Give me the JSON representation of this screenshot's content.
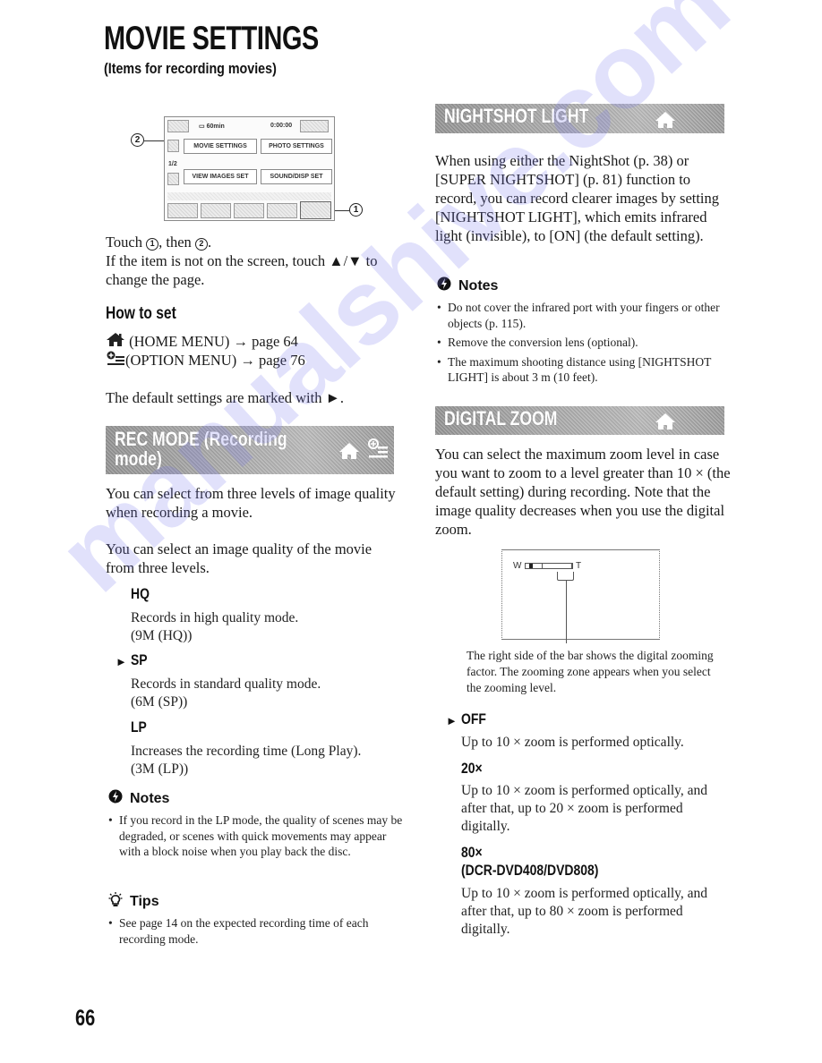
{
  "page": {
    "title": "MOVIE SETTINGS",
    "subtitle": "(Items for recording movies)",
    "page_number": "66",
    "watermark": "manualshive.com"
  },
  "lcd_screen": {
    "battery_time": "60min",
    "timecode": "0:00:00",
    "page_indicator": "1/2",
    "buttons": [
      "MOVIE SETTINGS",
      "PHOTO SETTINGS",
      "VIEW IMAGES SET",
      "SOUND/DISP SET"
    ],
    "callout_1": "1",
    "callout_2": "2"
  },
  "instructions": {
    "touch_prefix": "Touch ",
    "touch_mid": ", then ",
    "touch_suffix": ".",
    "circle_1": "1",
    "circle_2": "2",
    "line2": "If the item is not on the screen, touch ▲/▼ to change the page."
  },
  "how_to_set": {
    "heading": "How to set",
    "home_menu": "(HOME MENU) → page 64",
    "option_menu": "(OPTION MENU) → page 76",
    "default_note": "The default settings are marked with ►."
  },
  "rec_mode": {
    "banner_line1": "REC MODE (Recording",
    "banner_line2": "mode)",
    "intro1": "You can select from three levels of image quality when recording a movie.",
    "intro2": "You can select an image quality of the movie from three levels.",
    "options": [
      {
        "label": "HQ",
        "default": false,
        "desc": "Records in high quality mode.",
        "sub": "(9M (HQ))"
      },
      {
        "label": "SP",
        "default": true,
        "desc": "Records in standard quality mode.",
        "sub": "(6M (SP))"
      },
      {
        "label": "LP",
        "default": false,
        "desc": "Increases the recording time (Long Play).",
        "sub": "(3M (LP))"
      }
    ],
    "notes_heading": "Notes",
    "notes": [
      "If you record in the LP mode, the quality of scenes may be degraded, or scenes with quick movements may appear with a block noise when you play back the disc."
    ],
    "tips_heading": "Tips",
    "tips": [
      "See page 14 on the expected recording time of each recording mode."
    ]
  },
  "nightshot_light": {
    "banner": "NIGHTSHOT LIGHT",
    "body": "When using either the NightShot  (p. 38) or [SUPER NIGHTSHOT] (p. 81) function to record, you can record clearer images by setting [NIGHTSHOT LIGHT], which emits infrared light (invisible), to [ON] (the default setting).",
    "notes_heading": "Notes",
    "notes": [
      "Do not cover the infrared port with your fingers or other objects (p. 115).",
      "Remove the conversion lens (optional).",
      "The maximum shooting distance using [NIGHTSHOT LIGHT] is about 3 m (10 feet)."
    ]
  },
  "digital_zoom": {
    "banner": "DIGITAL ZOOM",
    "body": "You can select the maximum zoom level in case you want to zoom to a level greater than 10 × (the default setting) during recording. Note that the image quality decreases when you use the digital zoom.",
    "diagram_w": "W",
    "diagram_t": "T",
    "caption": "The right side of the bar shows the digital zooming factor. The zooming zone appears when you select the zooming level.",
    "options": [
      {
        "label": "OFF",
        "default": true,
        "desc": "Up to 10 × zoom is performed optically."
      },
      {
        "label": "20×",
        "default": false,
        "desc": "Up to 10 × zoom is performed optically, and after that, up to 20 × zoom is performed digitally."
      },
      {
        "label": "80×",
        "label2": "(DCR-DVD408/DVD808)",
        "default": false,
        "desc": "Up to 10 × zoom is performed optically, and after that, up to 80 × zoom is performed digitally."
      }
    ]
  },
  "icons": {
    "default_marker": "►",
    "home": "home-icon",
    "option": "option-menu-icon",
    "notes": "notes-icon",
    "tips": "lightbulb-icon"
  }
}
